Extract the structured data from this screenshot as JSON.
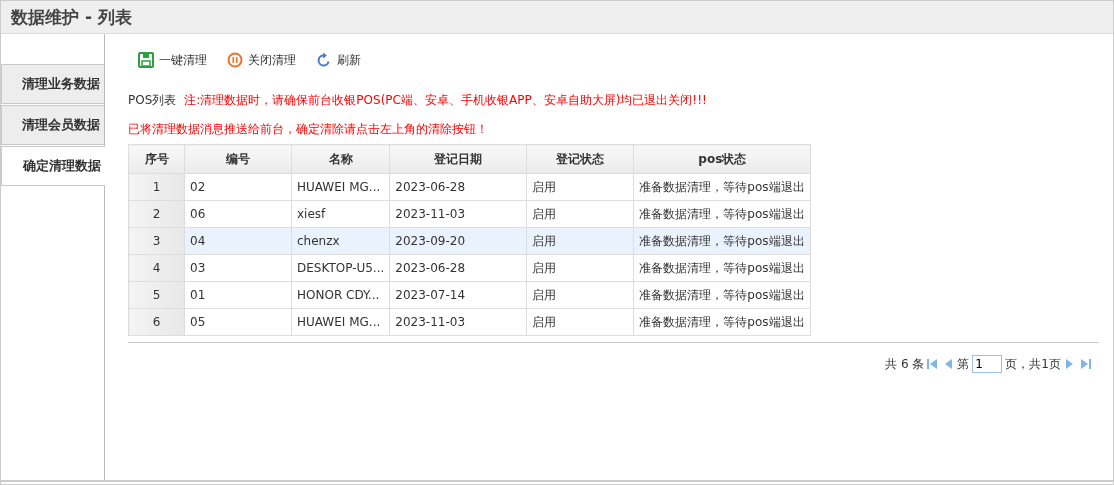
{
  "window": {
    "title": "数据维护 - 列表"
  },
  "sidebar": {
    "items": [
      {
        "label": "清理业务数据",
        "selected": false
      },
      {
        "label": "清理会员数据",
        "selected": false
      },
      {
        "label": "确定清理数据",
        "selected": true
      }
    ]
  },
  "toolbar": [
    {
      "kind": "save",
      "label": "一键清理"
    },
    {
      "kind": "stop",
      "label": "关闭清理"
    },
    {
      "kind": "refresh",
      "label": "刷新"
    }
  ],
  "list_label": "POS列表",
  "notes": [
    "注:清理数据时，请确保前台收银POS(PC端、安卓、手机收银APP、安卓自助大屏)均已退出关闭!!!",
    "已将清理数据消息推送给前台，确定清除请点击左上角的清除按钮！"
  ],
  "table": {
    "columns": [
      "序号",
      "编号",
      "名称",
      "登记日期",
      "登记状态",
      "pos状态"
    ],
    "rows": [
      {
        "selected": false,
        "cells": [
          "1",
          "02",
          "HUAWEI MG...",
          "2023-06-28",
          "启用",
          "准备数据清理，等待pos端退出"
        ]
      },
      {
        "selected": false,
        "cells": [
          "2",
          "06",
          "xiesf",
          "2023-11-03",
          "启用",
          "准备数据清理，等待pos端退出"
        ]
      },
      {
        "selected": true,
        "cells": [
          "3",
          "04",
          "chenzx",
          "2023-09-20",
          "启用",
          "准备数据清理，等待pos端退出"
        ]
      },
      {
        "selected": false,
        "cells": [
          "4",
          "03",
          "DESKTOP-U5...",
          "2023-06-28",
          "启用",
          "准备数据清理，等待pos端退出"
        ]
      },
      {
        "selected": false,
        "cells": [
          "5",
          "01",
          "HONOR CDY...",
          "2023-07-14",
          "启用",
          "准备数据清理，等待pos端退出"
        ]
      },
      {
        "selected": false,
        "cells": [
          "6",
          "05",
          "HUAWEI MG...",
          "2023-11-03",
          "启用",
          "准备数据清理，等待pos端退出"
        ]
      }
    ]
  },
  "pager": {
    "total": "共 6 条",
    "page_prefix": "第",
    "page": "1",
    "page_suffix": "页，共1页"
  }
}
